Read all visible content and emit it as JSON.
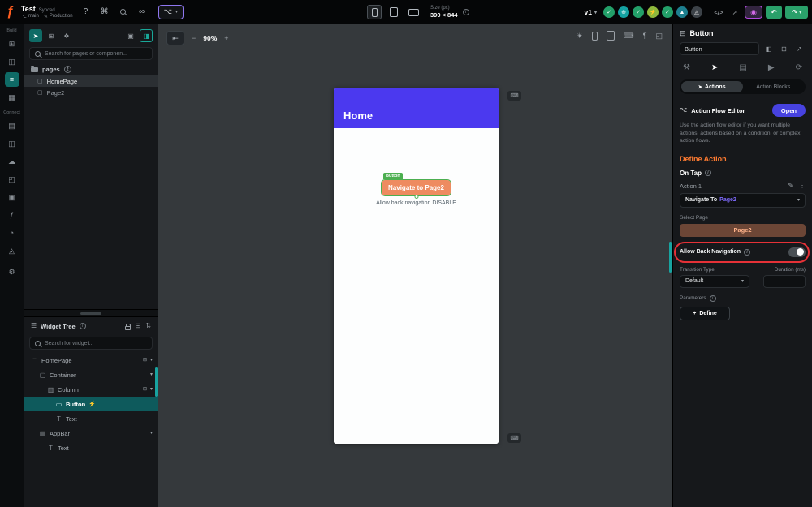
{
  "topbar": {
    "project": "Test",
    "synced": "Synced",
    "branch": "main",
    "environment": "Production",
    "size_label": "Size (px)",
    "size_value": "390 × 844",
    "version": "v1"
  },
  "rail": {
    "build_label": "Build",
    "connect_label": "Connect"
  },
  "pages_panel": {
    "search_placeholder": "Search for pages or componen...",
    "folder_label": "pages",
    "folder_badge": "2",
    "pages": [
      {
        "name": "HomePage"
      },
      {
        "name": "Page2"
      }
    ]
  },
  "widget_tree": {
    "title": "Widget Tree",
    "search_placeholder": "Search for widget...",
    "items": [
      {
        "label": "HomePage"
      },
      {
        "label": "Container"
      },
      {
        "label": "Column"
      },
      {
        "label": "Button"
      },
      {
        "label": "Text"
      },
      {
        "label": "AppBar"
      },
      {
        "label": "Text"
      }
    ]
  },
  "canvas": {
    "zoom": "90%"
  },
  "phone": {
    "appbar_title": "Home",
    "selection_tag": "Button",
    "button_label": "Navigate to Page2",
    "caption": "Allow back navigation DISABLE"
  },
  "properties": {
    "header_title": "Button",
    "name_value": "Button",
    "tab_actions": "Actions",
    "tab_action_blocks": "Action Blocks",
    "flow_editor_label": "Action Flow Editor",
    "open_button": "Open",
    "flow_description": "Use the action flow editor if you want multiple actions, actions based on a condition, or complex action flows.",
    "define_action_title": "Define Action",
    "on_tap_label": "On Tap",
    "action_label": "Action 1",
    "nav_prefix": "Navigate To",
    "nav_target": "Page2",
    "select_page_label": "Select Page",
    "selected_page": "Page2",
    "allow_back_label": "Allow Back Navigation",
    "transition_label": "Transition Type",
    "transition_value": "Default",
    "duration_label": "Duration (ms)",
    "parameters_label": "Parameters",
    "define_button": "Define"
  },
  "colors": {
    "accent_teal": "#0f6b66",
    "primary_purple": "#4b39ef",
    "button_orange": "#ee8b60",
    "define_orange": "#ff7b31",
    "open_blue": "#4742e0",
    "annotation_red": "#e53137",
    "success_green": "#2aa06a"
  },
  "icons": {
    "logo": "ƒ",
    "help": "?",
    "command": "⌘",
    "link": "∞",
    "branch": "⌥",
    "pencil": "✎",
    "chevron_down": "▾",
    "chevron_right": "▸",
    "undo": "↶",
    "redo": "↷",
    "check": "✓",
    "plus_circle": "⊕",
    "bolt": "⚡",
    "rocket": "▲",
    "puzzle": "◬",
    "code": "</>",
    "share": "↗",
    "eye": "◉",
    "collapse": "⇤",
    "minus": "−",
    "plus": "+",
    "sun": "☀",
    "keyboard": "⌨",
    "text_dir": "¶",
    "crop": "◱",
    "cursor": "➤",
    "grid": "⊞",
    "tag": "❖",
    "page_add": "▣",
    "template": "◨",
    "info": "i",
    "menu": "☰",
    "sort": "⇅",
    "board": "⊟",
    "page": "▢",
    "container": "▢",
    "column": "▥",
    "button_widget": "▭",
    "text_widget": "T",
    "appbar": "▤",
    "dots": "⋮",
    "flow": "⌥",
    "tools": "⚒",
    "pointer": "➤",
    "list": "▤",
    "play": "▶",
    "rotate": "⟳",
    "palette": "◧",
    "copy": "⊞",
    "expand": "↗",
    "gear": "⚙",
    "rail_dash": "⊞",
    "rail_builder": "≡",
    "rail_widgets": "▦",
    "rail_story": "◫",
    "rail_db": "▤",
    "rail_types": "◫",
    "rail_api": "☁",
    "rail_storage": "◰",
    "rail_media": "▣",
    "rail_functions": "ƒ",
    "rail_charts": "◔",
    "rail_ext": "◬"
  }
}
